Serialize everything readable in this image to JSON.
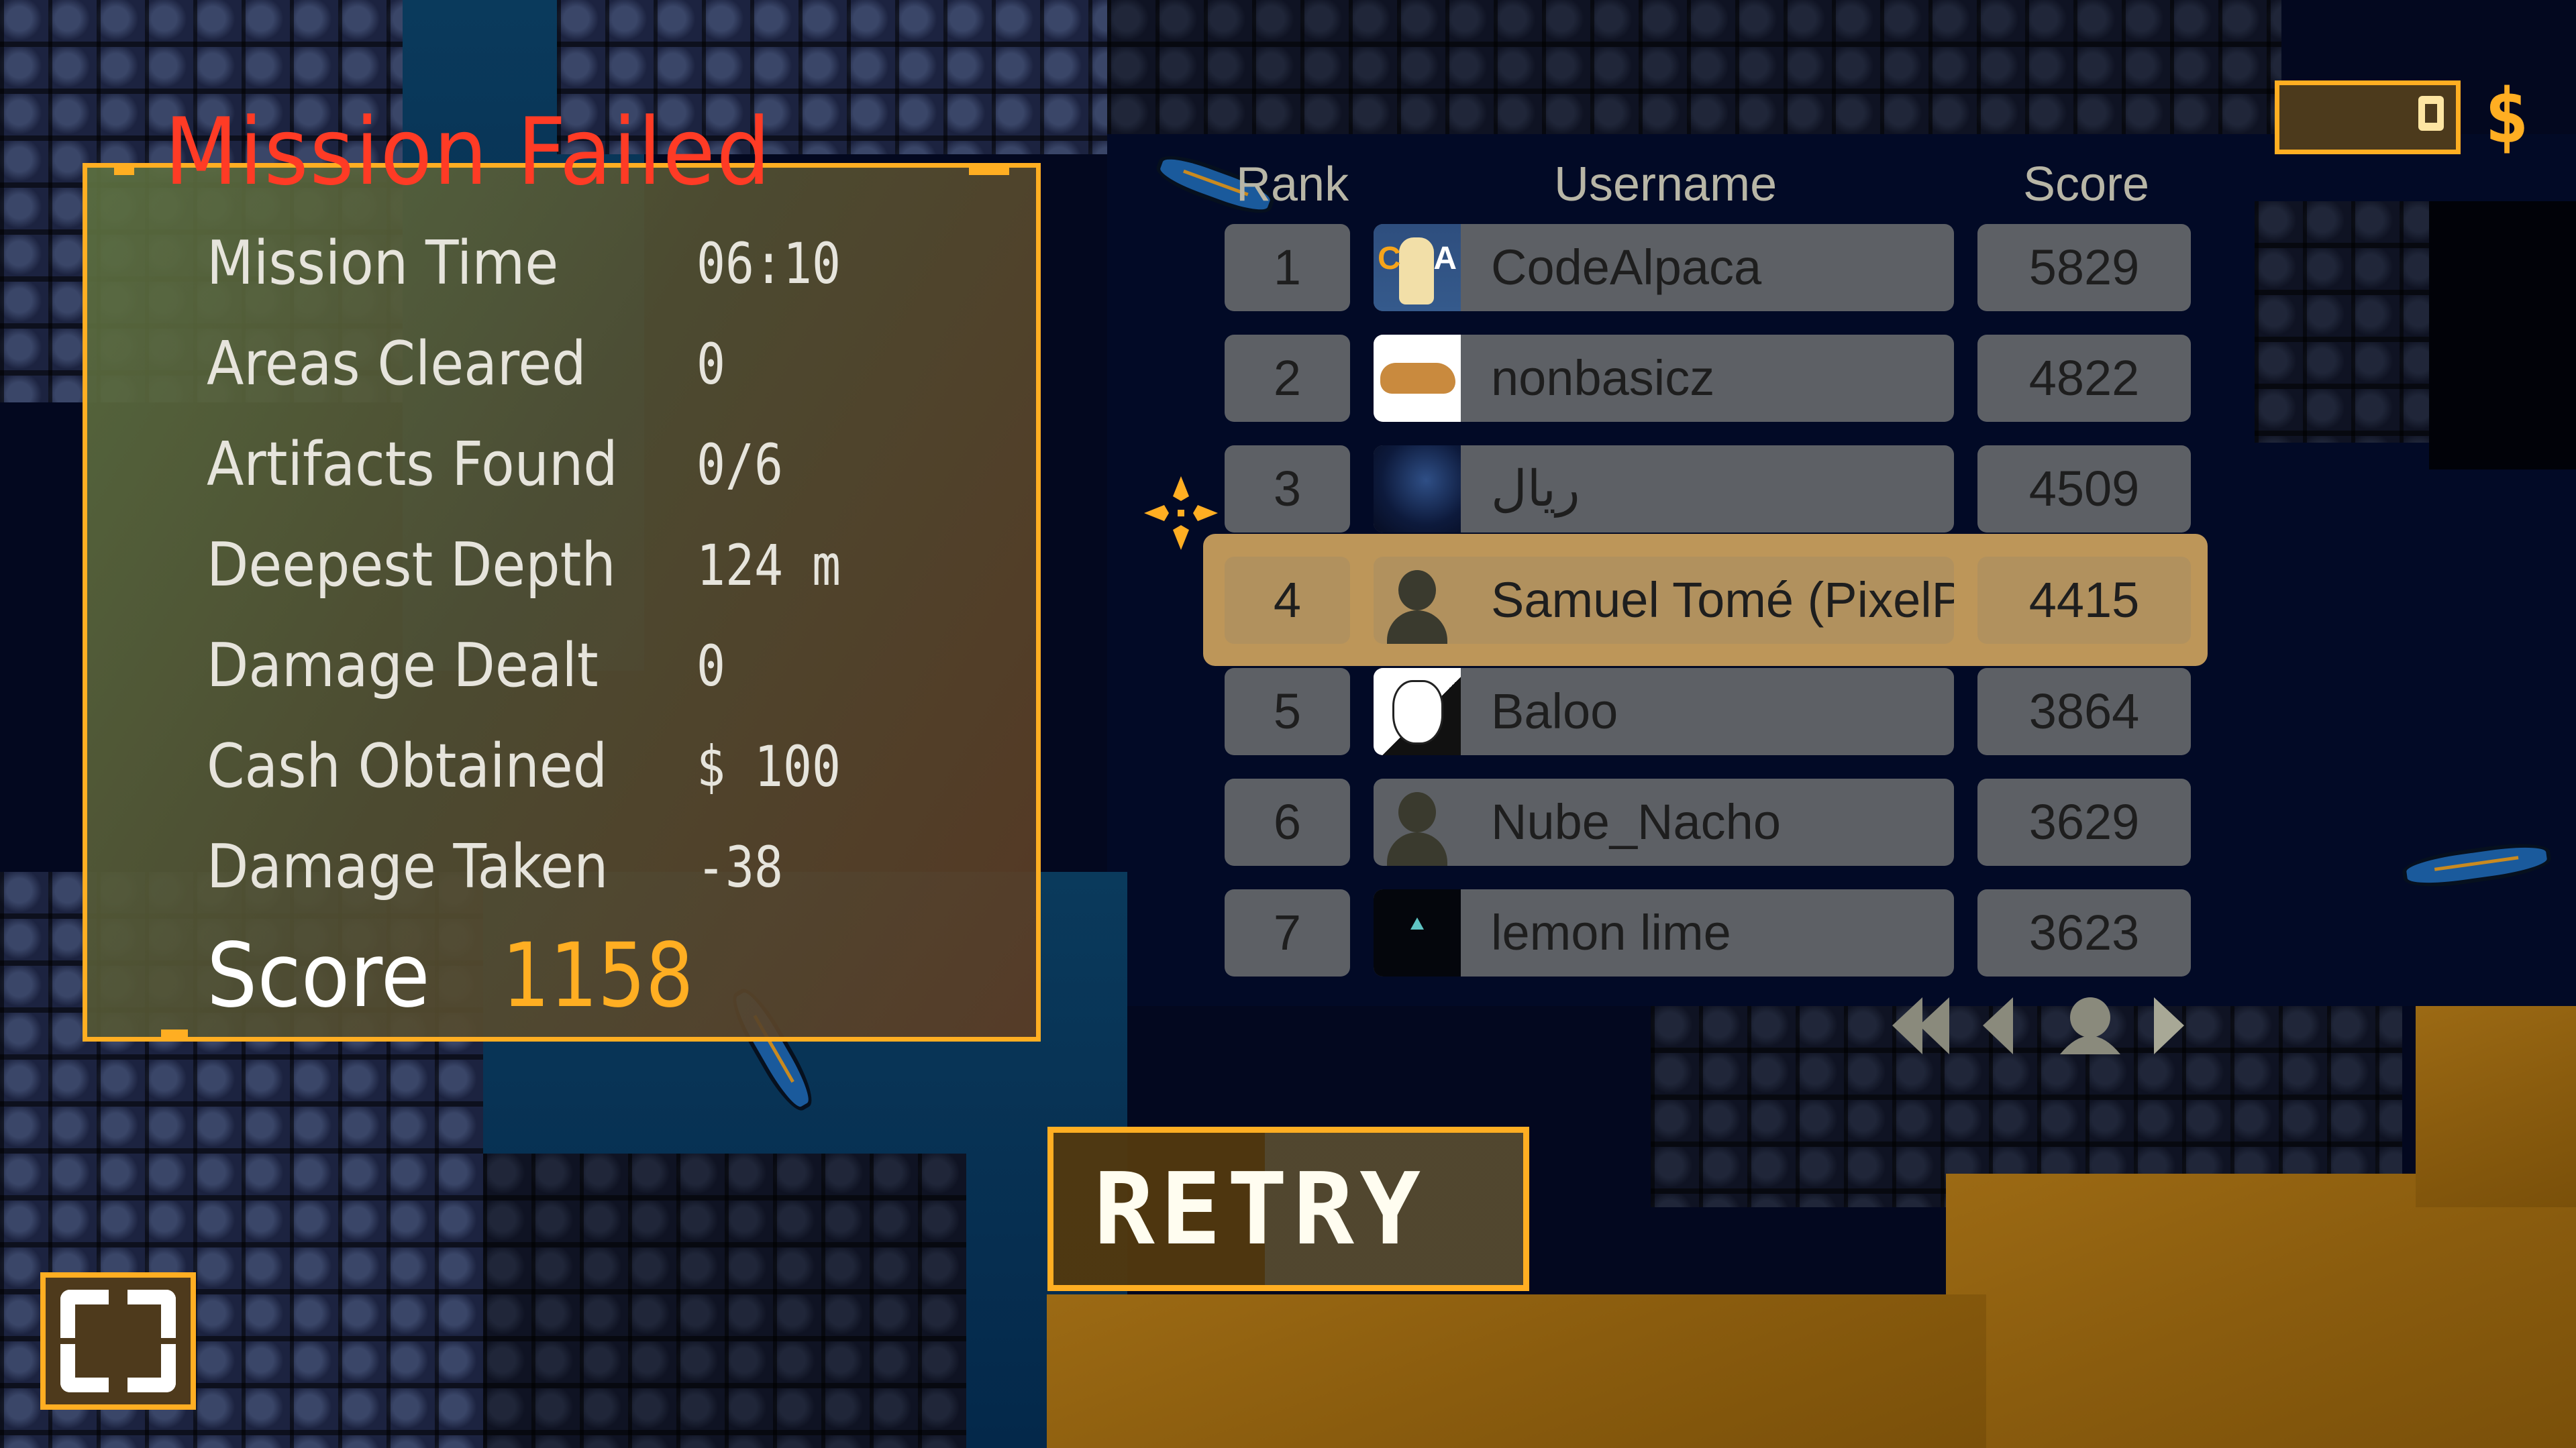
{
  "title": "Mission Failed",
  "stats": [
    {
      "label": "Mission Time",
      "value": "06:10"
    },
    {
      "label": "Areas Cleared",
      "value": "0"
    },
    {
      "label": "Artifacts Found",
      "value": "0/6"
    },
    {
      "label": "Deepest Depth",
      "value": "124 m"
    },
    {
      "label": "Damage Dealt",
      "value": "0"
    },
    {
      "label": "Cash Obtained",
      "value": "$ 100"
    },
    {
      "label": "Damage Taken",
      "value": "-38"
    }
  ],
  "score": {
    "label": "Score",
    "value": "1158"
  },
  "leaderboard": {
    "headers": {
      "rank": "Rank",
      "username": "Username",
      "score": "Score"
    },
    "rows": [
      {
        "rank": "1",
        "username": "CodeAlpaca",
        "score": "5829",
        "avatar": "alpaca-avatar"
      },
      {
        "rank": "2",
        "username": "nonbasicz",
        "score": "4822",
        "avatar": "dog-avatar"
      },
      {
        "rank": "3",
        "username": "ريال",
        "score": "4509",
        "avatar": "space-avatar"
      },
      {
        "rank": "4",
        "username": "Samuel Tomé (PixelP",
        "score": "4415",
        "avatar": "default-avatar",
        "highlighted": true
      },
      {
        "rank": "5",
        "username": "Baloo",
        "score": "3864",
        "avatar": "manga-avatar"
      },
      {
        "rank": "6",
        "username": "Nube_Nacho",
        "score": "3629",
        "avatar": "default-avatar"
      },
      {
        "rank": "7",
        "username": "lemon lime",
        "score": "3623",
        "avatar": "dark-avatar"
      }
    ],
    "pagination": [
      "first-page",
      "previous-page",
      "my-rank",
      "next-page"
    ]
  },
  "cash": {
    "value": "0",
    "currency_symbol": "$"
  },
  "buttons": {
    "retry": "RETRY",
    "fullscreen": "fullscreen"
  },
  "colors": {
    "accent": "#ffae22",
    "title_red": "#ff3b25",
    "score_gold": "#ffae22",
    "text_light": "#e6e4dc",
    "highlight_row": "#d2a55f"
  }
}
